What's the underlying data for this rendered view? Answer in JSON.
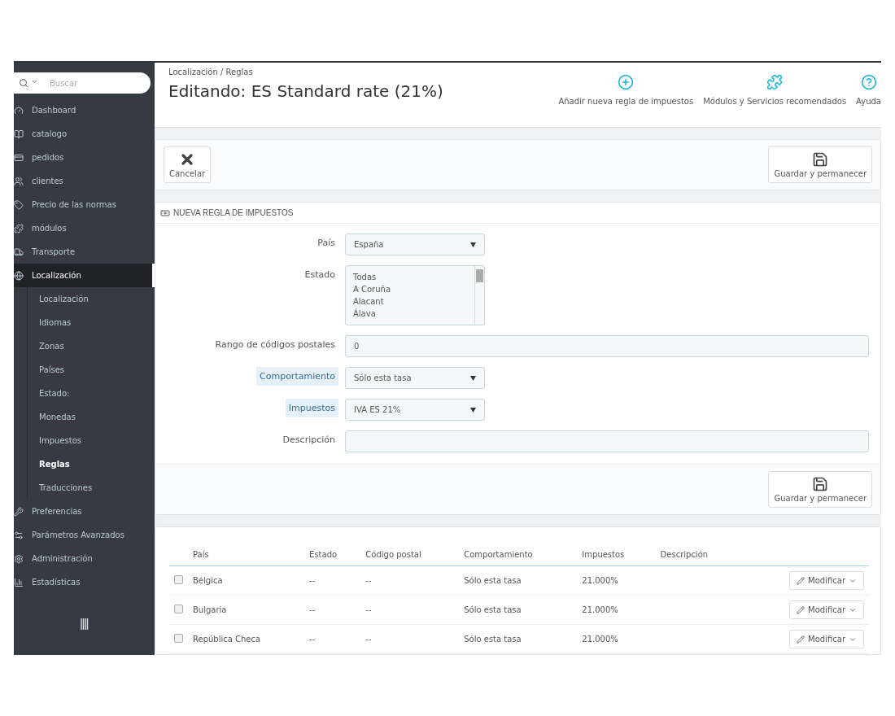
{
  "sidebar": {
    "search": {
      "placeholder": "Buscar"
    },
    "items": [
      {
        "label": "Dashboard",
        "selected": false
      },
      {
        "label": "catalogo",
        "selected": false
      },
      {
        "label": "pedidos",
        "selected": false
      },
      {
        "label": "clientes",
        "selected": false
      },
      {
        "label": "Precio de las normas",
        "selected": false
      },
      {
        "label": "módulos",
        "selected": false
      },
      {
        "label": "Transporte",
        "selected": false
      },
      {
        "label": "Localización",
        "selected": true,
        "expanded": true,
        "children": [
          {
            "label": "Localización",
            "selected": false
          },
          {
            "label": "Idiomas",
            "selected": false
          },
          {
            "label": "Zonas",
            "selected": false
          },
          {
            "label": "Países",
            "selected": false
          },
          {
            "label": "Estado:",
            "selected": false
          },
          {
            "label": "Monedas",
            "selected": false
          },
          {
            "label": "Impuestos",
            "selected": false
          },
          {
            "label": "Reglas",
            "selected": true
          },
          {
            "label": "Traducciones",
            "selected": false
          }
        ]
      },
      {
        "label": "Preferencias",
        "selected": false
      },
      {
        "label": "Parámetros Avanzados",
        "selected": false
      },
      {
        "label": "Administración",
        "selected": false
      },
      {
        "label": "Estadísticas",
        "selected": false
      }
    ]
  },
  "header": {
    "breadcrumb": "Localización / Reglas",
    "title": "Editando: ES Standard rate (21%)",
    "actions": [
      "Añadir nueva regla de impuestos",
      "Módulos y Servicios recomendados",
      "Ayuda"
    ]
  },
  "toolbar": {
    "cancel": "Cancelar",
    "save": "Guardar y permanecer"
  },
  "form": {
    "title": "NUEVA REGLA DE IMPUESTOS",
    "fields": [
      {
        "label": "País",
        "kind": "select",
        "value": "España",
        "highlighted": false
      },
      {
        "label": "Estado",
        "kind": "listbox",
        "options": [
          "Todas",
          "A Coruña",
          "Alacant",
          "Álava"
        ],
        "highlighted": false
      },
      {
        "label": "Rango de códigos postales",
        "kind": "text",
        "value": "0",
        "highlighted": false
      },
      {
        "label": "Comportamiento",
        "kind": "select",
        "value": "Sólo esta tasa",
        "highlighted": true
      },
      {
        "label": "Impuestos",
        "kind": "select",
        "value": "IVA ES 21%",
        "highlighted": true
      },
      {
        "label": "Descripción",
        "kind": "text",
        "highlighted": false
      }
    ],
    "save": "Guardar y permanecer"
  },
  "table": {
    "columns": [
      "País",
      "Estado",
      "Código postal",
      "Comportamiento",
      "Impuestos",
      "Descripción"
    ],
    "rows": [
      {
        "checked": false,
        "cells": [
          "Bélgica",
          "--",
          "--",
          "Sólo esta tasa",
          "21.000%",
          ""
        ],
        "action": "Modificar"
      },
      {
        "checked": false,
        "cells": [
          "Bulgaria",
          "--",
          "--",
          "Sólo esta tasa",
          "21.000%",
          ""
        ],
        "action": "Modificar"
      },
      {
        "checked": false,
        "cells": [
          "República Checa",
          "--",
          "--",
          "Sólo esta tasa",
          "21.000%",
          ""
        ],
        "action": "Modificar"
      }
    ]
  }
}
